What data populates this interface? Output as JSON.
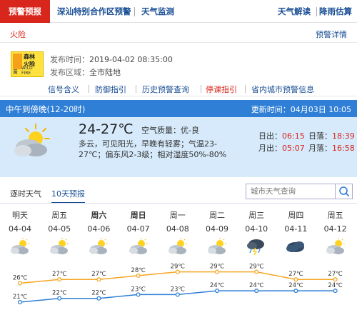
{
  "nav": {
    "alarm": "预警预报",
    "items": [
      "深汕特别合作区预警",
      "天气监测"
    ],
    "right": [
      "天气解读",
      "降雨估算"
    ]
  },
  "warning": {
    "tab": "火险",
    "detail": "预警详情",
    "icon": {
      "line1": "森林",
      "line2": "火险",
      "level": "黄",
      "en": "WILD FIRE"
    },
    "published_label": "发布时间：",
    "published": "2019-04-02 08:35:00",
    "area_label": "发布区域：",
    "area": "全市陆地",
    "links": [
      "信号含义",
      "防御指引",
      "历史预警查询",
      "停课指引",
      "省内城市预警信息"
    ]
  },
  "current": {
    "period": "中午到傍晚(12-20时)",
    "updated": "更新时间：04月03日 10:05",
    "temp": "24-27℃",
    "air_label": "空气质量：",
    "air": "优-良",
    "desc": "多云，可见阳光，早晚有轻雾；气温23-27℃；偏东风2-3级；相对湿度50%-80%",
    "sunrise_label": "日出：",
    "sunrise": "06:15",
    "sunset_label": "日落：",
    "sunset": "18:39",
    "moonrise_label": "月出：",
    "moonrise": "05:07",
    "moonset_label": "月落：",
    "moonset": "16:58",
    "icon": "cloudy-sun-icon"
  },
  "forecast": {
    "tabs": [
      "逐时天气",
      "10天预报"
    ],
    "search_placeholder": "城市天气查询",
    "days": [
      {
        "day": "明天",
        "date": "04-04",
        "icon": "cloudy-sun-icon",
        "high": 26,
        "low": 21,
        "bold": false
      },
      {
        "day": "周五",
        "date": "04-05",
        "icon": "cloudy-sun-icon",
        "high": 27,
        "low": 22,
        "bold": false
      },
      {
        "day": "周六",
        "date": "04-06",
        "icon": "cloudy-sun-icon",
        "high": 27,
        "low": 22,
        "bold": true
      },
      {
        "day": "周日",
        "date": "04-07",
        "icon": "cloudy-sun-icon",
        "high": 28,
        "low": 23,
        "bold": true
      },
      {
        "day": "周一",
        "date": "04-08",
        "icon": "cloudy-sun-icon",
        "high": 29,
        "low": 23,
        "bold": false
      },
      {
        "day": "周二",
        "date": "04-09",
        "icon": "cloudy-sun-icon",
        "high": 29,
        "low": 24,
        "bold": false
      },
      {
        "day": "周三",
        "date": "04-10",
        "icon": "thunderstorm-icon",
        "high": 29,
        "low": 24,
        "bold": false
      },
      {
        "day": "周四",
        "date": "04-11",
        "icon": "overcast-icon",
        "high": 27,
        "low": 24,
        "bold": false
      },
      {
        "day": "周五",
        "date": "04-12",
        "icon": "cloudy-sun-icon",
        "high": 27,
        "low": 24,
        "bold": false
      }
    ],
    "unit": "℃"
  },
  "colors": {
    "alarm_red": "#d9261c",
    "link_blue": "#1a4f95",
    "band_blue": "#2f7fd6",
    "band_bg": "#d6eafb",
    "high_line": "#f5a623",
    "low_line": "#2f7fd6"
  }
}
